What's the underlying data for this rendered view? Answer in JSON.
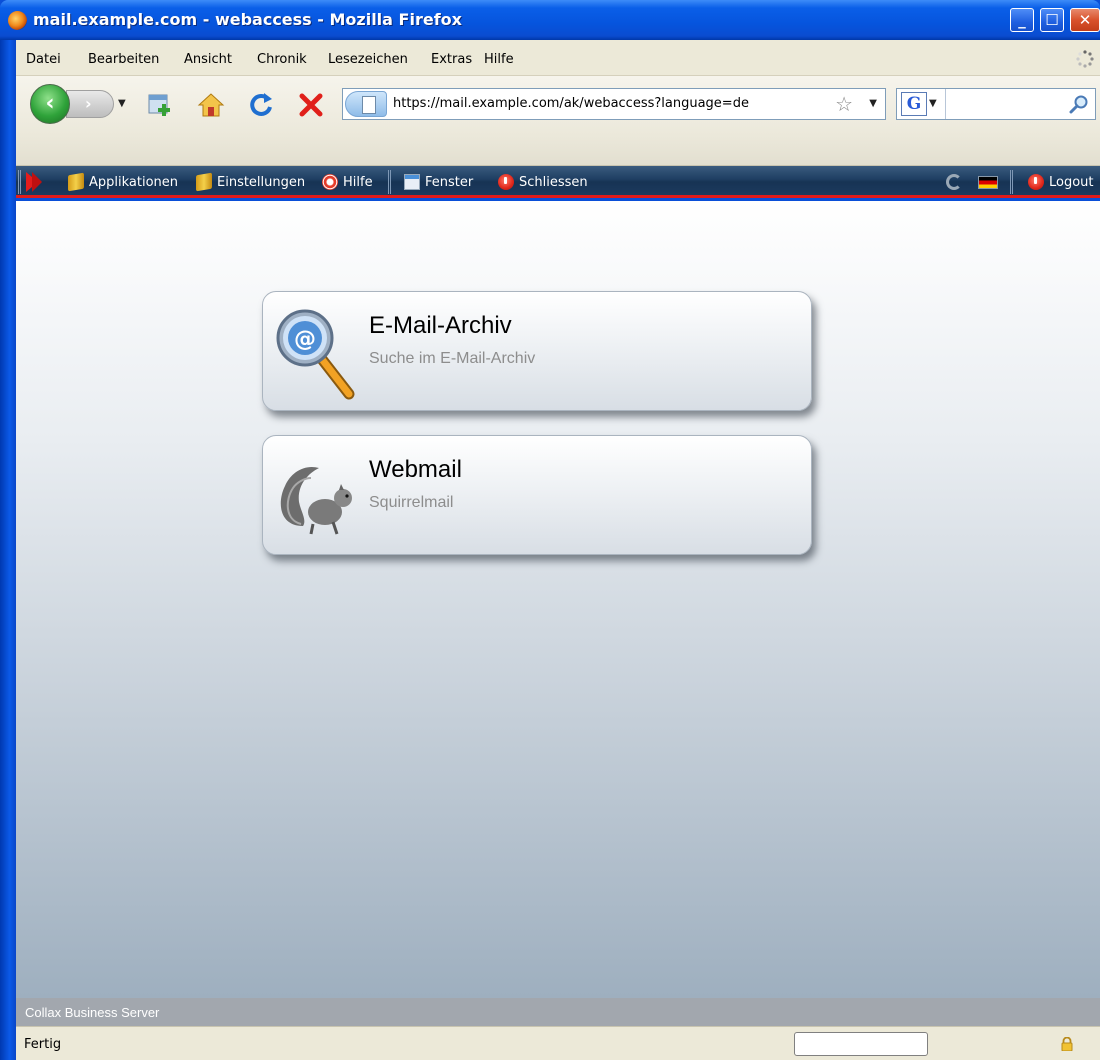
{
  "window": {
    "title": "mail.example.com - webaccess - Mozilla Firefox"
  },
  "menu": {
    "items": [
      "Datei",
      "Bearbeiten",
      "Ansicht",
      "Chronik",
      "Lesezeichen",
      "Extras",
      "Hilfe"
    ]
  },
  "navigation": {
    "url": "https://mail.example.com/ak/webaccess?language=de",
    "search_value": "",
    "search_engine": "G"
  },
  "app_toolbar": {
    "applications": "Applikationen",
    "settings": "Einstellungen",
    "help": "Hilfe",
    "window": "Fenster",
    "close": "Schliessen",
    "logout": "Logout",
    "accent_color": "#e11b1b"
  },
  "apps": [
    {
      "title": "E-Mail-Archiv",
      "subtitle": "Suche im E-Mail-Archiv",
      "icon": "email-search-icon"
    },
    {
      "title": "Webmail",
      "subtitle": "Squirrelmail",
      "icon": "squirrel-icon"
    }
  ],
  "footer": {
    "product": "Collax Business Server"
  },
  "status": {
    "text": "Fertig"
  }
}
